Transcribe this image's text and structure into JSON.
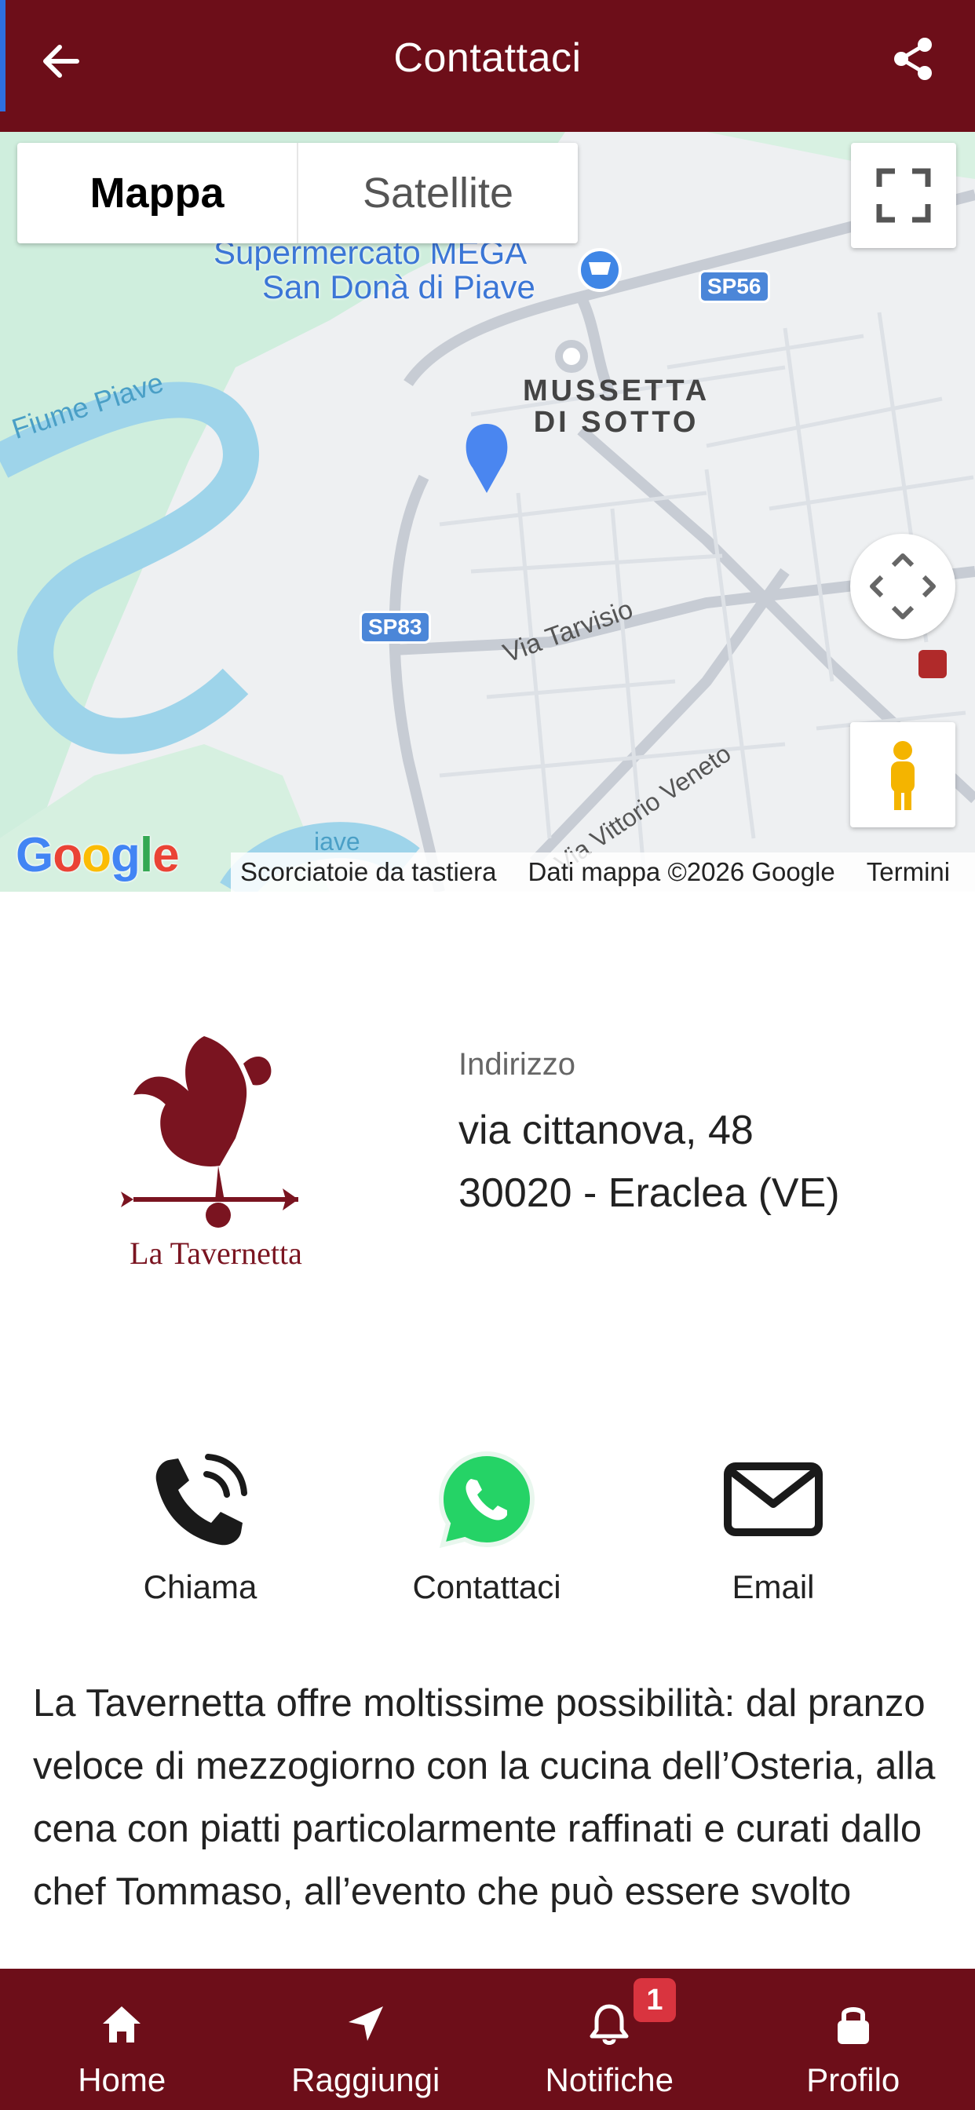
{
  "header": {
    "title": "Contattaci",
    "background": "#6d0e19"
  },
  "map": {
    "type_options": [
      "Mappa",
      "Satellite"
    ],
    "selected_type": "Mappa",
    "labels": {
      "poi_line1": "Supermercato MEGA",
      "poi_line2": "San Donà di Piave",
      "district_line1": "MUSSETTA",
      "district_line2": "DI SOTTO",
      "river": "Fiume Piave",
      "river2": "iave",
      "road_sp56": "SP56",
      "road_sp83": "SP83",
      "street_tarvisio": "Via Tarvisio",
      "street_vittorio": "Via Vittorio Veneto"
    },
    "google_logo": "Google",
    "attribution": {
      "shortcuts": "Scorciatoie da tastiera",
      "data": "Dati mappa ©2026 Google",
      "terms": "Termini"
    }
  },
  "address": {
    "logo_text": "La Tavernetta",
    "label": "Indirizzo",
    "line1": "via cittanova, 48",
    "line2": "30020 - Eraclea (VE)"
  },
  "actions": [
    {
      "label": "Chiama",
      "icon": "phone-call-icon"
    },
    {
      "label": "Contattaci",
      "icon": "whatsapp-icon"
    },
    {
      "label": "Email",
      "icon": "envelope-icon"
    }
  ],
  "description": "La Tavernetta offre moltissime possibilità: dal pranzo veloce di mezzogiorno con la cucina dell’Osteria, alla cena con piatti particolarmente raffinati e curati dallo chef Tommaso, all’evento che può essere svolto",
  "bottom_nav": {
    "items": [
      {
        "label": "Home",
        "icon": "home-icon"
      },
      {
        "label": "Raggiungi",
        "icon": "navigation-arrow-icon"
      },
      {
        "label": "Notifiche",
        "icon": "bell-icon",
        "badge": "1"
      },
      {
        "label": "Profilo",
        "icon": "lock-icon"
      }
    ]
  },
  "colors": {
    "brand": "#6d0e19",
    "badge": "#d9343f",
    "map_pin": "#4a86f0",
    "whatsapp": "#25d366"
  }
}
